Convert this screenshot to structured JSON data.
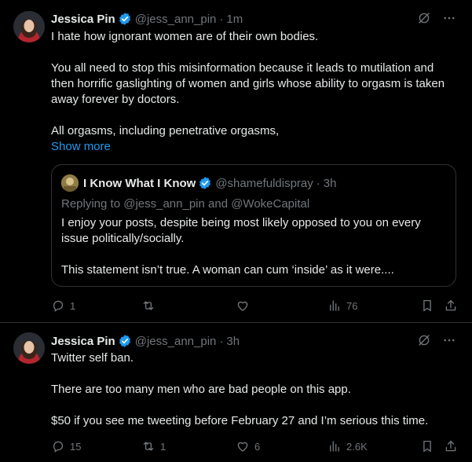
{
  "tweets": [
    {
      "name": "Jessica Pin",
      "handle": "@jess_ann_pin",
      "time": "1m",
      "body": {
        "line1": "I hate how ignorant women are of their own bodies.",
        "para2": "You all need to stop this misinformation because it leads to mutilation and then horrific gaslighting of women and girls whose ability to orgasm is taken away forever by doctors.",
        "para3": "All orgasms, including penetrative orgasms,",
        "show_more": "Show more"
      },
      "quote": {
        "name": "I Know What I Know",
        "handle": "@shamefuldispray",
        "time": "3h",
        "replying": "Replying to @jess_ann_pin and @WokeCapital",
        "para1": "I enjoy your posts, despite being most likely opposed to you on every issue politically/socially.",
        "para2": "This statement isn’t true. A woman can cum ‘inside’ as it were...."
      },
      "actions": {
        "replies": "1",
        "retweets": "",
        "likes": "",
        "views": "76"
      }
    },
    {
      "name": "Jessica Pin",
      "handle": "@jess_ann_pin",
      "time": "3h",
      "body": {
        "line1": "Twitter self ban.",
        "para2": "There are too many men who are bad people on this app.",
        "para3": "$50 if you see me tweeting before February 27 and I’m serious this time."
      },
      "actions": {
        "replies": "15",
        "retweets": "1",
        "likes": "6",
        "views": "2.6K"
      }
    }
  ],
  "separator": "·",
  "colors": {
    "background": "#000000",
    "text": "#e7e9ea",
    "muted": "#71767b",
    "link": "#1d9bf0",
    "border": "#2f3336",
    "verified": "#1d9bf0"
  },
  "icons": [
    "verified-badge-icon",
    "grok-icon",
    "more-icon",
    "reply-icon",
    "retweet-icon",
    "like-icon",
    "views-icon",
    "bookmark-icon",
    "share-icon"
  ]
}
